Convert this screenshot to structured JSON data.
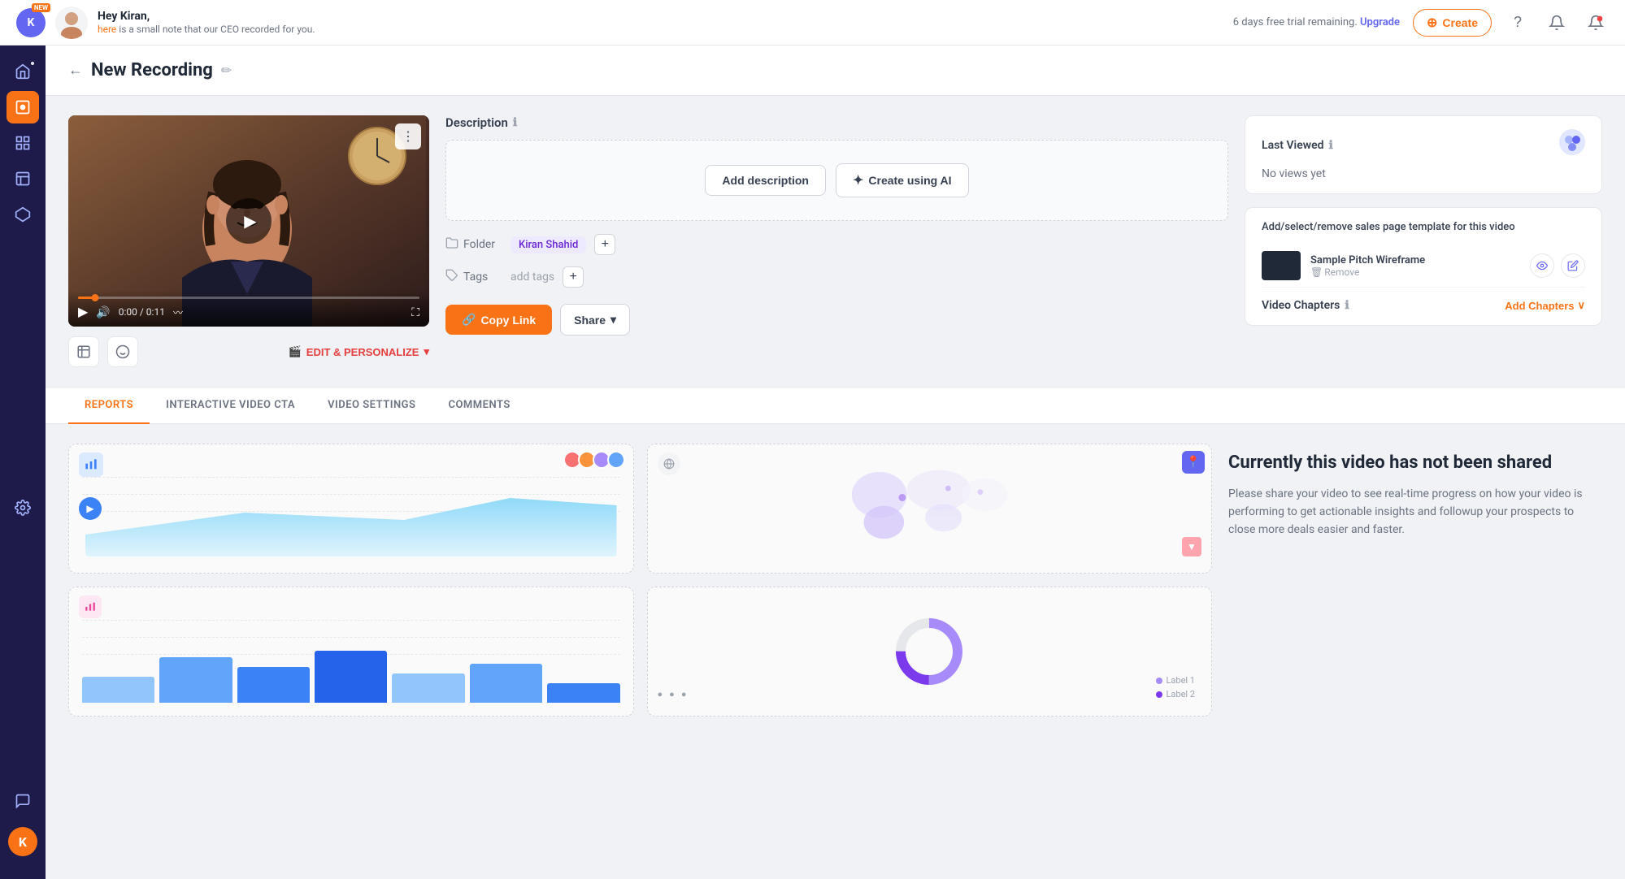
{
  "topbar": {
    "badge": "NEW",
    "greeting_name": "Hey Kiran,",
    "greeting_note_pre": "",
    "greeting_link": "here",
    "greeting_note": " is a small note that our CEO recorded for you.",
    "trial_text": "6 days free trial remaining.",
    "trial_link": "Upgrade",
    "create_label": "Create",
    "help_icon": "?",
    "notification_icon": "🔔",
    "alert_icon": "🔔"
  },
  "sidebar": {
    "items": [
      {
        "id": "home",
        "icon": "⌂",
        "active": false
      },
      {
        "id": "recordings",
        "icon": "📁",
        "active": true
      },
      {
        "id": "analytics",
        "icon": "▦",
        "active": false
      },
      {
        "id": "pages",
        "icon": "▣",
        "active": false
      },
      {
        "id": "integrations",
        "icon": "⬡",
        "active": false
      },
      {
        "id": "settings",
        "icon": "⚙",
        "active": false
      }
    ],
    "bottom_items": [
      {
        "id": "chat",
        "icon": "💬"
      },
      {
        "id": "user",
        "icon": "K"
      }
    ]
  },
  "page": {
    "title": "New Recording",
    "back_label": "←"
  },
  "video": {
    "duration": "0:00 / 0:11",
    "more_label": "⋮",
    "play_icon": "▶",
    "volume_icon": "🔊",
    "fullscreen_icon": "⛶",
    "edit_personalize": "EDIT & PERSONALIZE",
    "screenshot_icon": "🖼",
    "face_icon": "😊"
  },
  "description": {
    "label": "Description",
    "add_btn": "Add description",
    "ai_btn": "Create using AI",
    "ai_icon": "✦"
  },
  "folder": {
    "label": "Folder",
    "folder_icon": "📁",
    "folder_name": "Kiran Shahid",
    "add_icon": "+"
  },
  "tags": {
    "label": "Tags",
    "tag_icon": "🏷",
    "placeholder": "add tags",
    "add_icon": "+"
  },
  "actions": {
    "copy_link": "Copy Link",
    "link_icon": "🔗",
    "share_label": "Share",
    "share_arrow": "▾"
  },
  "last_viewed": {
    "title": "Last Viewed",
    "no_views": "No views yet",
    "info_icon": "ℹ"
  },
  "sales_page": {
    "title": "Add/select/remove sales page template for this video",
    "template_name": "Sample Pitch Wireframe",
    "remove_label": "Remove",
    "remove_icon": "🗑",
    "view_icon": "👁",
    "edit_icon": "✏"
  },
  "chapters": {
    "label": "Video Chapters",
    "info_icon": "ℹ",
    "add_label": "Add Chapters",
    "expand_icon": "∨"
  },
  "tabs": [
    {
      "id": "reports",
      "label": "REPORTS",
      "active": true
    },
    {
      "id": "cta",
      "label": "INTERACTIVE VIDEO CTA",
      "active": false
    },
    {
      "id": "settings",
      "label": "VIDEO SETTINGS",
      "active": false
    },
    {
      "id": "comments",
      "label": "COMMENTS",
      "active": false
    }
  ],
  "not_shared": {
    "title": "Currently this video has not been shared",
    "description": "Please share your video to see real-time progress on how your video is performing to get actionable insights and followup your prospects to close more deals easier and faster."
  },
  "charts": [
    {
      "id": "area",
      "type": "area",
      "dashed": true
    },
    {
      "id": "map",
      "type": "map",
      "dashed": true
    },
    {
      "id": "bar",
      "type": "bar",
      "dashed": true
    },
    {
      "id": "donut",
      "type": "donut",
      "dashed": true
    }
  ]
}
